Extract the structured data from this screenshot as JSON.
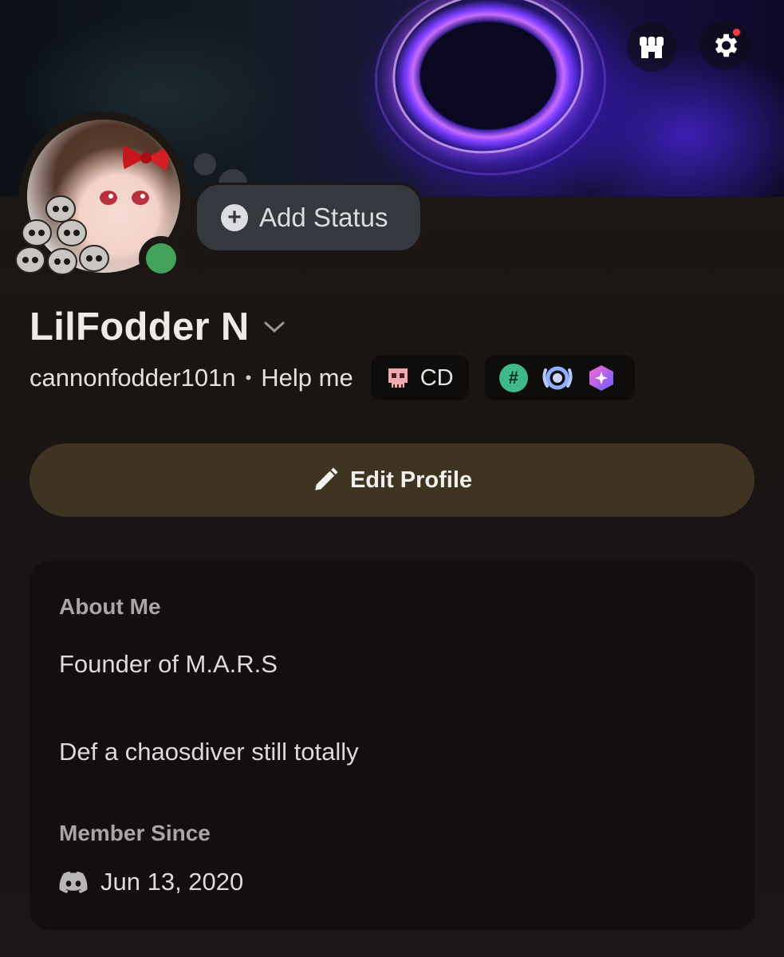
{
  "header": {
    "shop_icon": "shop-icon",
    "settings_icon": "gear-icon",
    "settings_notification": true
  },
  "profile": {
    "display_name": "LilFodder N",
    "username": "cannonfodder101n",
    "separator": "•",
    "custom_status": "Help me",
    "server_tag": "CD",
    "online_status": "online",
    "status_color": "#43a25a",
    "badges": [
      "hashtag-badge",
      "quest-badge",
      "nitro-badge"
    ]
  },
  "add_status": {
    "label": "Add Status"
  },
  "actions": {
    "edit_profile_label": "Edit Profile"
  },
  "about": {
    "heading": "About Me",
    "line1": "Founder of M.A.R.S",
    "line2": "Def a chaosdiver still totally"
  },
  "member_since": {
    "heading": "Member Since",
    "date": "Jun 13, 2020"
  },
  "colors": {
    "accent_button": "#3e3421",
    "card_bg": "#130e10",
    "bubble_bg": "#363840"
  }
}
